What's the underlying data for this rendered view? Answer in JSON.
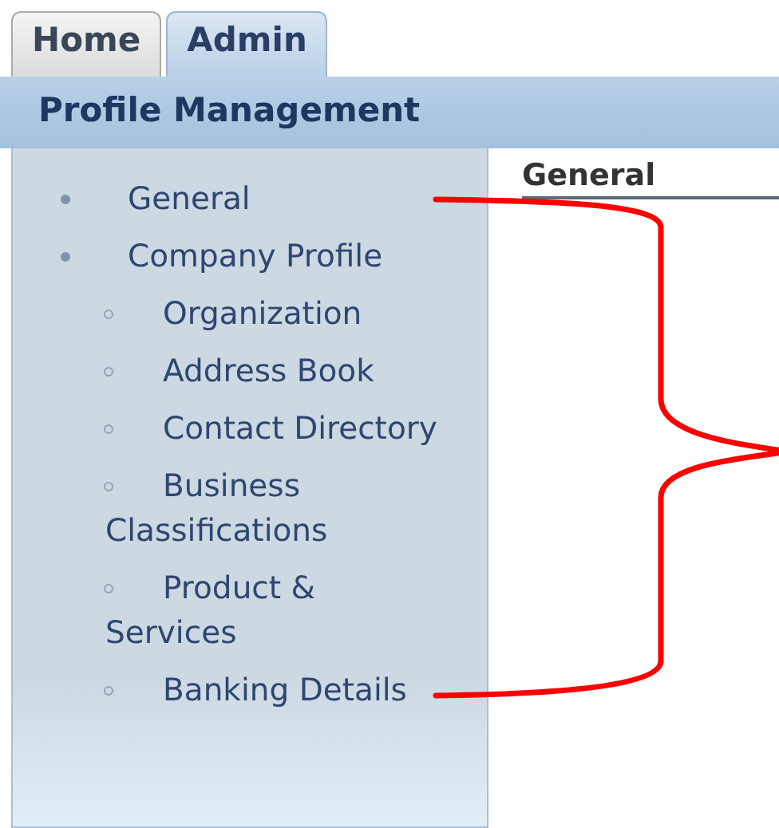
{
  "tabs": [
    {
      "label": "Home",
      "selected": false
    },
    {
      "label": "Admin",
      "selected": true
    }
  ],
  "header": {
    "title": "Profile Management"
  },
  "sidebar": {
    "items": [
      {
        "label": "General"
      },
      {
        "label": "Company Profile",
        "children": [
          {
            "label": "Organization"
          },
          {
            "label": "Address Book"
          },
          {
            "label": "Contact Directory"
          },
          {
            "label": "Business Classifications"
          },
          {
            "label": "Product & Services"
          },
          {
            "label": "Banking Details"
          }
        ]
      }
    ]
  },
  "content": {
    "heading": "General"
  }
}
